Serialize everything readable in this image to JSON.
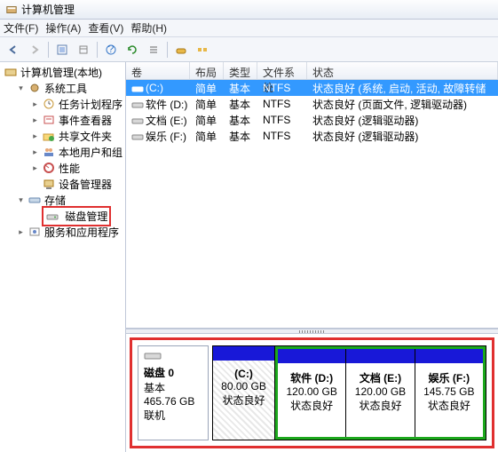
{
  "window": {
    "title": "计算机管理"
  },
  "menu": {
    "file": "文件(F)",
    "action": "操作(A)",
    "view": "查看(V)",
    "help": "帮助(H)"
  },
  "tree": {
    "root": "计算机管理(本地)",
    "systools": "系统工具",
    "tasksched": "任务计划程序",
    "eventvwr": "事件查看器",
    "shared": "共享文件夹",
    "localuser": "本地用户和组",
    "perf": "性能",
    "devmgr": "设备管理器",
    "storage": "存储",
    "diskmgmt": "磁盘管理",
    "services": "服务和应用程序"
  },
  "cols": {
    "vol": "卷",
    "layout": "布局",
    "type": "类型",
    "fs": "文件系统",
    "status": "状态"
  },
  "rows": [
    {
      "vol": "(C:)",
      "layout": "简单",
      "type": "基本",
      "fs": "NTFS",
      "status": "状态良好 (系统, 启动, 活动, 故障转储"
    },
    {
      "vol": "软件 (D:)",
      "layout": "简单",
      "type": "基本",
      "fs": "NTFS",
      "status": "状态良好 (页面文件, 逻辑驱动器)"
    },
    {
      "vol": "文档 (E:)",
      "layout": "简单",
      "type": "基本",
      "fs": "NTFS",
      "status": "状态良好 (逻辑驱动器)"
    },
    {
      "vol": "娱乐 (F:)",
      "layout": "简单",
      "type": "基本",
      "fs": "NTFS",
      "status": "状态良好 (逻辑驱动器)"
    }
  ],
  "disk": {
    "name": "磁盘 0",
    "type": "基本",
    "size": "465.76 GB",
    "online": "联机"
  },
  "parts": [
    {
      "label": "(C:)",
      "size": "80.00 GB",
      "status": "状态良好"
    },
    {
      "label": "软件 (D:)",
      "size": "120.00 GB",
      "status": "状态良好"
    },
    {
      "label": "文档 (E:)",
      "size": "120.00 GB",
      "status": "状态良好"
    },
    {
      "label": "娱乐 (F:)",
      "size": "145.75 GB",
      "status": "状态良好"
    }
  ]
}
